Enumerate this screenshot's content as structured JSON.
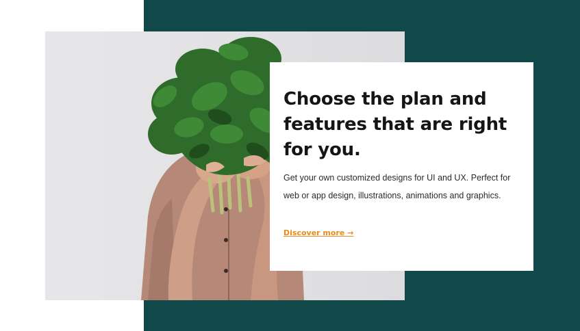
{
  "hero": {
    "title": "Choose the plan and features that are right for you.",
    "description": "Get your own customized designs for UI and UX. Perfect for web or app design, illustrations, animations and graphics.",
    "link_label": "Discover more →"
  },
  "colors": {
    "panel_background": "#11484a",
    "card_background": "#ffffff",
    "accent_link": "#e98a1e",
    "title_text": "#151515"
  },
  "image": {
    "subject": "person holding bunch of green herbs in front of face"
  }
}
